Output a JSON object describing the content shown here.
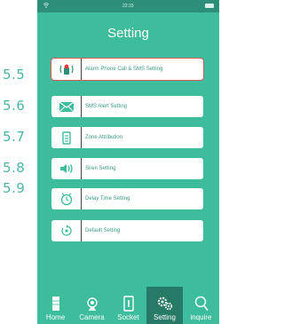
{
  "step_labels": [
    "5.5",
    "5.6",
    "5.7",
    "5.8",
    "5.9"
  ],
  "statusbar": {
    "time": "22:33"
  },
  "header": {
    "title": "Setting"
  },
  "menu": {
    "items": [
      {
        "label": "Alarm Phone Call & SMS Setting",
        "icon": "phone-alarm-icon",
        "selected": true
      },
      {
        "label": "SMS Alert Setting",
        "icon": "envelope-icon",
        "selected": false
      },
      {
        "label": "Zone Attribution",
        "icon": "zone-icon",
        "selected": false
      },
      {
        "label": "Siren Setting",
        "icon": "speaker-icon",
        "selected": false
      },
      {
        "label": "Delay Time Setting",
        "icon": "clock-icon",
        "selected": false
      },
      {
        "label": "Default Setting",
        "icon": "reset-icon",
        "selected": false
      }
    ]
  },
  "nav": {
    "items": [
      {
        "label": "Home",
        "icon": "home-icon",
        "active": false
      },
      {
        "label": "Camera",
        "icon": "camera-icon",
        "active": false
      },
      {
        "label": "Socket",
        "icon": "socket-icon",
        "active": false
      },
      {
        "label": "Setting",
        "icon": "gears-icon",
        "active": true
      },
      {
        "label": "inquire",
        "icon": "search-icon",
        "active": false
      }
    ]
  },
  "colors": {
    "accent": "#3dbd9c",
    "dark": "#267a66",
    "highlight": "#d65a5a"
  }
}
